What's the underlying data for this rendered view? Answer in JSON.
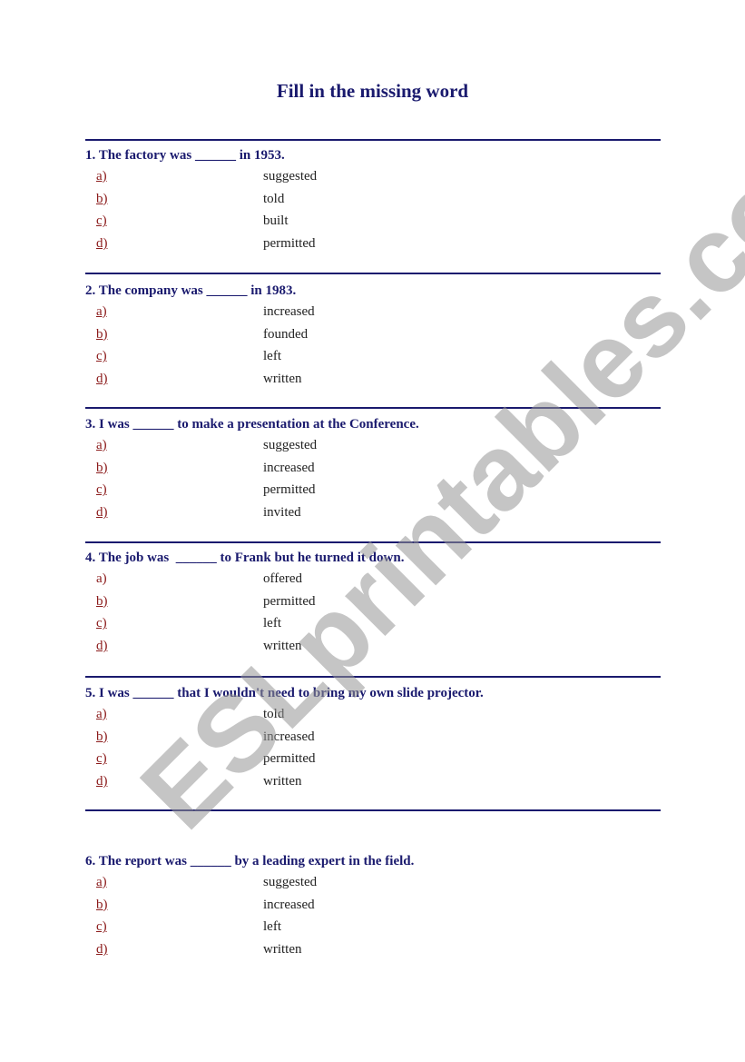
{
  "title": "Fill in the missing word",
  "watermark": "ESLprintables.com",
  "questions": [
    {
      "text": "1. The factory was ______ in 1953.",
      "options": [
        {
          "letter": "a)",
          "word": "suggested"
        },
        {
          "letter": "b)",
          "word": "told"
        },
        {
          "letter": "c)",
          "word": "built"
        },
        {
          "letter": "d)",
          "word": "permitted"
        }
      ]
    },
    {
      "text": "2. The company was ______ in 1983.",
      "options": [
        {
          "letter": "a)",
          "word": "increased"
        },
        {
          "letter": "b)",
          "word": "founded"
        },
        {
          "letter": "c)",
          "word": "left"
        },
        {
          "letter": "d)",
          "word": "written"
        }
      ]
    },
    {
      "text": "3. I was ______ to make a presentation at the Conference.",
      "options": [
        {
          "letter": "a)",
          "word": "suggested"
        },
        {
          "letter": "b)",
          "word": "increased"
        },
        {
          "letter": "c)",
          "word": "permitted"
        },
        {
          "letter": "d)",
          "word": "invited"
        }
      ]
    },
    {
      "text": "4. The job was  ______ to Frank but he turned it down.",
      "options": [
        {
          "letter": "a)",
          "word": "offered"
        },
        {
          "letter": "b)",
          "word": "permitted"
        },
        {
          "letter": "c)",
          "word": "left"
        },
        {
          "letter": "d)",
          "word": "written"
        }
      ]
    },
    {
      "text": "5. I was ______ that I wouldn't need to bring my own slide projector.",
      "options": [
        {
          "letter": "a)",
          "word": "told"
        },
        {
          "letter": "b)",
          "word": "increased"
        },
        {
          "letter": "c)",
          "word": "permitted"
        },
        {
          "letter": "d)",
          "word": "written"
        }
      ]
    },
    {
      "text": "6. The report was ______ by a leading expert in the field.",
      "options": [
        {
          "letter": "a)",
          "word": "suggested"
        },
        {
          "letter": "b)",
          "word": "increased"
        },
        {
          "letter": "c)",
          "word": "left"
        },
        {
          "letter": "d)",
          "word": "written"
        }
      ]
    }
  ]
}
